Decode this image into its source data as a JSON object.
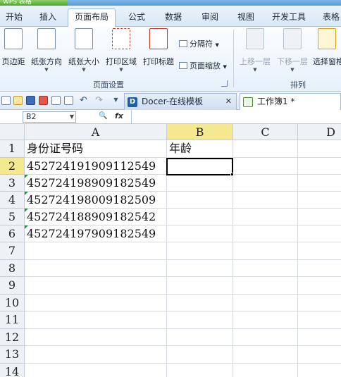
{
  "menu": {
    "app_badge": "WPS 表格",
    "items": [
      {
        "label": "开始"
      },
      {
        "label": "插入"
      },
      {
        "label": "页面布局",
        "active": true
      },
      {
        "label": "公式"
      },
      {
        "label": "数据"
      },
      {
        "label": "审阅"
      },
      {
        "label": "视图"
      },
      {
        "label": "开发工具"
      },
      {
        "label": "表格"
      }
    ]
  },
  "ribbon": {
    "page_setup": {
      "margins": "页边距",
      "orientation": "纸张方向",
      "size": "纸张大小",
      "print_area": "打印区域",
      "print_titles": "打印标题",
      "breaks": "分隔符",
      "scale": "页面缩放",
      "group_label": "页面设置"
    },
    "arrange": {
      "bring_forward": "上移一层",
      "send_backward": "下移一层",
      "selection_pane": "选择窗格",
      "group_label": "排列"
    }
  },
  "doc_tabs": {
    "docer": "Docer-在线模板",
    "workbook": "工作簿1 *"
  },
  "formula_bar": {
    "name_box": "B2",
    "fx": "fx",
    "value": ""
  },
  "sheet": {
    "columns": [
      "A",
      "B",
      "C",
      "D"
    ],
    "rows": [
      "1",
      "2",
      "3",
      "4",
      "5",
      "6",
      "7",
      "8",
      "9",
      "10",
      "11",
      "12",
      "13",
      "14"
    ],
    "cells": {
      "A1": "身份证号码",
      "B1": "年龄",
      "A2": "452724191909112549",
      "A3": "452724198909182549",
      "A4": "452724198009182509",
      "A5": "452724188909182542",
      "A6": "452724197909182549"
    },
    "selected_cell": "B2"
  },
  "colors": {
    "accent": "#5c9ad6",
    "selected_header": "#f5e98f",
    "text_number_flag": "#1d9a3b"
  }
}
